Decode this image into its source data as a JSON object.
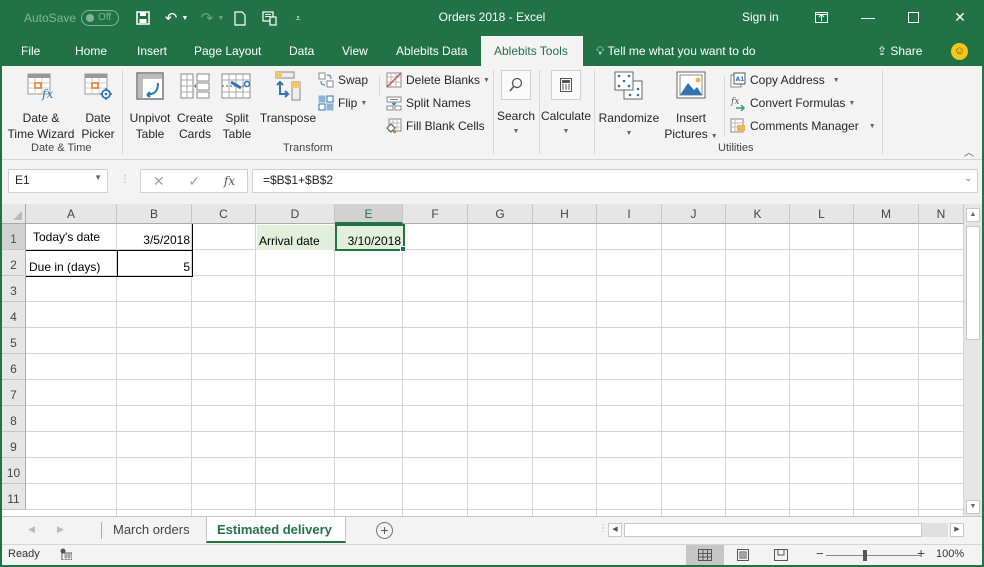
{
  "titlebar": {
    "autosave_label": "AutoSave",
    "autosave_state": "Off",
    "title": "Orders 2018  -  Excel",
    "signin": "Sign in"
  },
  "menu": {
    "tabs": [
      "File",
      "Home",
      "Insert",
      "Page Layout",
      "Data",
      "View",
      "Ablebits Data",
      "Ablebits Tools"
    ],
    "active_tab": "Ablebits Tools",
    "tell_me": "Tell me what you want to do",
    "share": "Share"
  },
  "ribbon": {
    "groups": {
      "date_time": {
        "label": "Date & Time",
        "buttons": [
          {
            "line1": "Date &",
            "line2": "Time Wizard",
            "icon": "date-time-wizard-icon"
          },
          {
            "line1": "Date",
            "line2": "Picker",
            "icon": "date-picker-icon"
          }
        ]
      },
      "transform": {
        "label": "Transform",
        "buttons": [
          {
            "line1": "Unpivot",
            "line2": "Table",
            "icon": "unpivot-table-icon"
          },
          {
            "line1": "Create",
            "line2": "Cards",
            "icon": "create-cards-icon"
          },
          {
            "line1": "Split",
            "line2": "Table",
            "icon": "split-table-icon"
          },
          {
            "line1": "Transpose",
            "line2": "",
            "icon": "transpose-icon"
          }
        ],
        "small_buttons": [
          {
            "label": "Swap",
            "icon": "swap-icon"
          },
          {
            "label": "Flip",
            "icon": "flip-icon",
            "dropdown": true
          },
          {
            "label": "Delete Blanks",
            "icon": "delete-blanks-icon",
            "dropdown": true
          },
          {
            "label": "Split Names",
            "icon": "split-names-icon"
          },
          {
            "label": "Fill Blank Cells",
            "icon": "fill-blank-cells-icon"
          }
        ]
      },
      "search": {
        "label": "Search"
      },
      "calculate": {
        "label": "Calculate"
      },
      "utilities": {
        "label": "Utilities",
        "buttons": [
          {
            "line1": "Randomize",
            "line2": "",
            "icon": "randomize-icon"
          },
          {
            "line1": "Insert",
            "line2": "Pictures",
            "icon": "insert-pictures-icon"
          }
        ],
        "small_buttons": [
          {
            "label": "Copy Address",
            "icon": "copy-address-icon",
            "dropdown": true
          },
          {
            "label": "Convert Formulas",
            "icon": "convert-formulas-icon",
            "dropdown": true
          },
          {
            "label": "Comments Manager",
            "icon": "comments-manager-icon",
            "dropdown": true
          }
        ]
      }
    }
  },
  "formula_bar": {
    "name_box": "E1",
    "formula": "=$B$1+$B$2"
  },
  "sheet": {
    "columns": [
      "A",
      "B",
      "C",
      "D",
      "E",
      "F",
      "G",
      "H",
      "I",
      "J",
      "K",
      "L",
      "M",
      "N"
    ],
    "rows": [
      "1",
      "2",
      "3",
      "4",
      "5",
      "6",
      "7",
      "8",
      "9",
      "10",
      "11"
    ],
    "selected_cell": "E1",
    "cells": {
      "A1": "Today's date",
      "B1": "3/5/2018",
      "A2": "Due in (days)",
      "B2": "5",
      "D1": "Arrival date",
      "E1": "3/10/2018"
    }
  },
  "sheet_tabs": [
    "March orders",
    "Estimated delivery"
  ],
  "active_sheet": "Estimated delivery",
  "status": {
    "ready": "Ready",
    "zoom": "100%"
  },
  "colors": {
    "brand": "#217346",
    "ribbon_bg": "#f3f3f3",
    "highlight_fill": "#e2efda"
  }
}
